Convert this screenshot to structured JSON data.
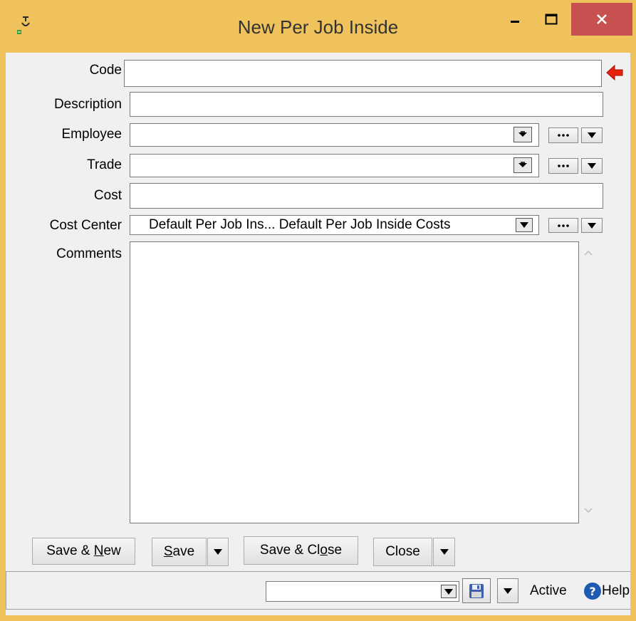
{
  "window": {
    "title": "New Per Job Inside"
  },
  "fields": {
    "code_label": "Code",
    "code_value": "",
    "description_label": "Description",
    "description_value": "",
    "employee_label": "Employee",
    "employee_value": "",
    "trade_label": "Trade",
    "trade_value": "",
    "cost_label": "Cost",
    "cost_value": "",
    "cost_center_label": "Cost Center",
    "cost_center_code": "Default Per Job Ins...",
    "cost_center_name": "Default Per Job Inside Costs",
    "comments_label": "Comments",
    "comments_value": ""
  },
  "buttons": {
    "save_new": {
      "pre": "Save & ",
      "key": "N",
      "post": "ew"
    },
    "save": {
      "pre": "",
      "key": "S",
      "post": "ave"
    },
    "save_close": {
      "pre": "Save & Cl",
      "key": "o",
      "post": "se"
    },
    "close": "Close"
  },
  "status": {
    "selector_value": "",
    "active_label": "Active",
    "help_label": "Help"
  },
  "icons": {
    "app": "desk-lamp-icon",
    "required": "red-arrow-left-icon",
    "ellipsis": "ellipsis-icon",
    "dropdown": "chevron-down-icon",
    "save_disk": "floppy-disk-icon",
    "help": "question-circle-icon"
  },
  "colors": {
    "title_bar": "#f0c25c",
    "close_button": "#c75050",
    "required_arrow": "#e8200e",
    "help_icon": "#1e5ab4"
  }
}
